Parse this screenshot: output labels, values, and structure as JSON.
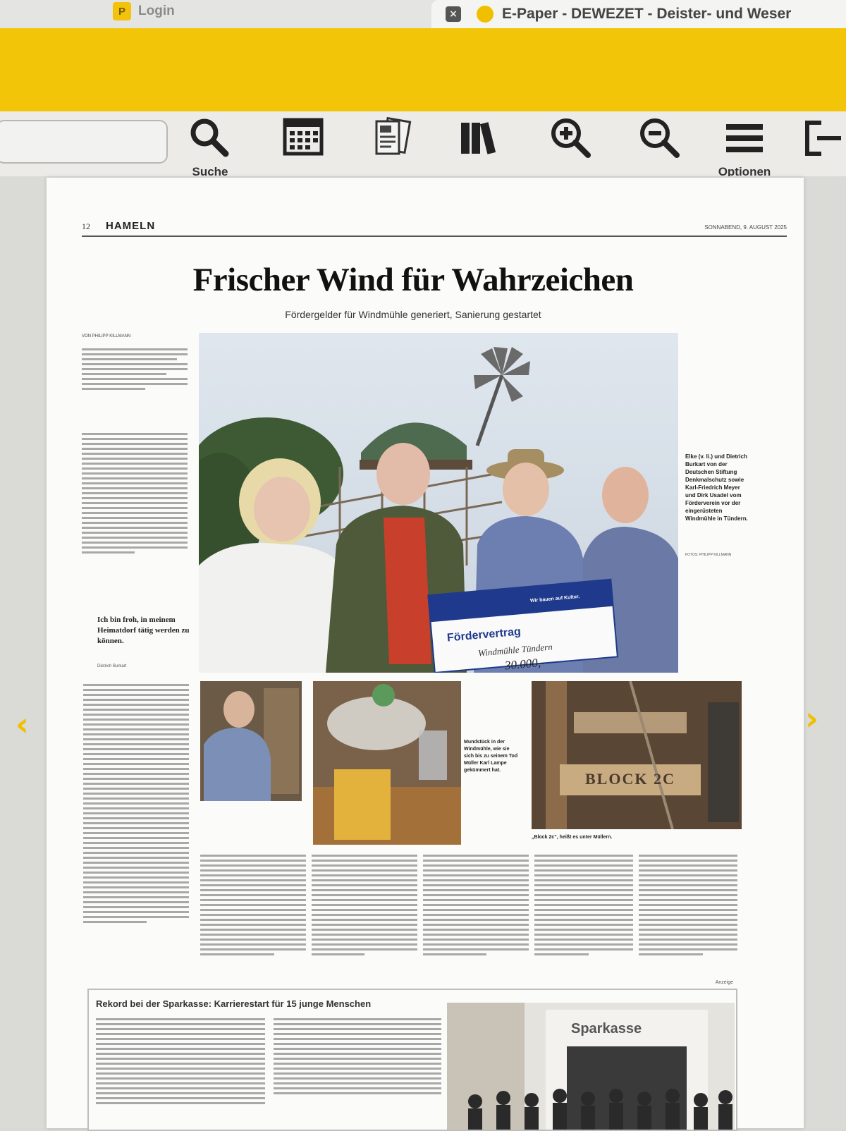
{
  "browser": {
    "tab_left_label": "Login",
    "tab_left_icon": "P",
    "tab_right_label": "E-Paper - DEWEZET - Deister- und Weser"
  },
  "colors": {
    "brand_yellow": "#f3c508",
    "toolbar_bg": "#ecebe8"
  },
  "toolbar": {
    "search_label": "Suche",
    "options_label": "Optionen"
  },
  "page": {
    "page_number": "12",
    "section": "HAMELN",
    "date": "SONNABEND, 9. AUGUST 2025",
    "headline": "Frischer Wind für Wahrzeichen",
    "subheadline": "Fördergelder für Windmühle generiert, Sanierung gestartet",
    "byline": "VON PHILIPP KILLMANN",
    "pull_quote": "Ich bin froh, in meinem Heimatdorf tätig werden zu können.",
    "pull_quote_attr": "Dietrich Burkart",
    "main_caption": "Elke (v. li.) und Dietrich Burkart von der Deutschen Stiftung Denkmalschutz sowie Karl-Friedrich Meyer und Dirk Usadel vom Förderverein vor der eingerüsteten Windmühle in Tündern.",
    "main_credit": "FOTOS: PHILIPP KILLMANN",
    "check_title": "Fördervertrag",
    "check_text": "Windmühle Tündern",
    "check_amount": "30.000,-",
    "check_tagline": "Wir bauen auf Kultur.",
    "mid_caption": "Mundstück in der Windmühle, wie sie sich bis zu seinem Tod Müller Karl Lampe gekümmert hat.",
    "right_caption": "„Block 2c“, heißt es unter Müllern.",
    "sign_text": "BLOCK 2C"
  },
  "ad": {
    "label": "Anzeige",
    "title": "Rekord bei der Sparkasse: Karrierestart für 15 junge Menschen",
    "brand": "Sparkasse"
  }
}
